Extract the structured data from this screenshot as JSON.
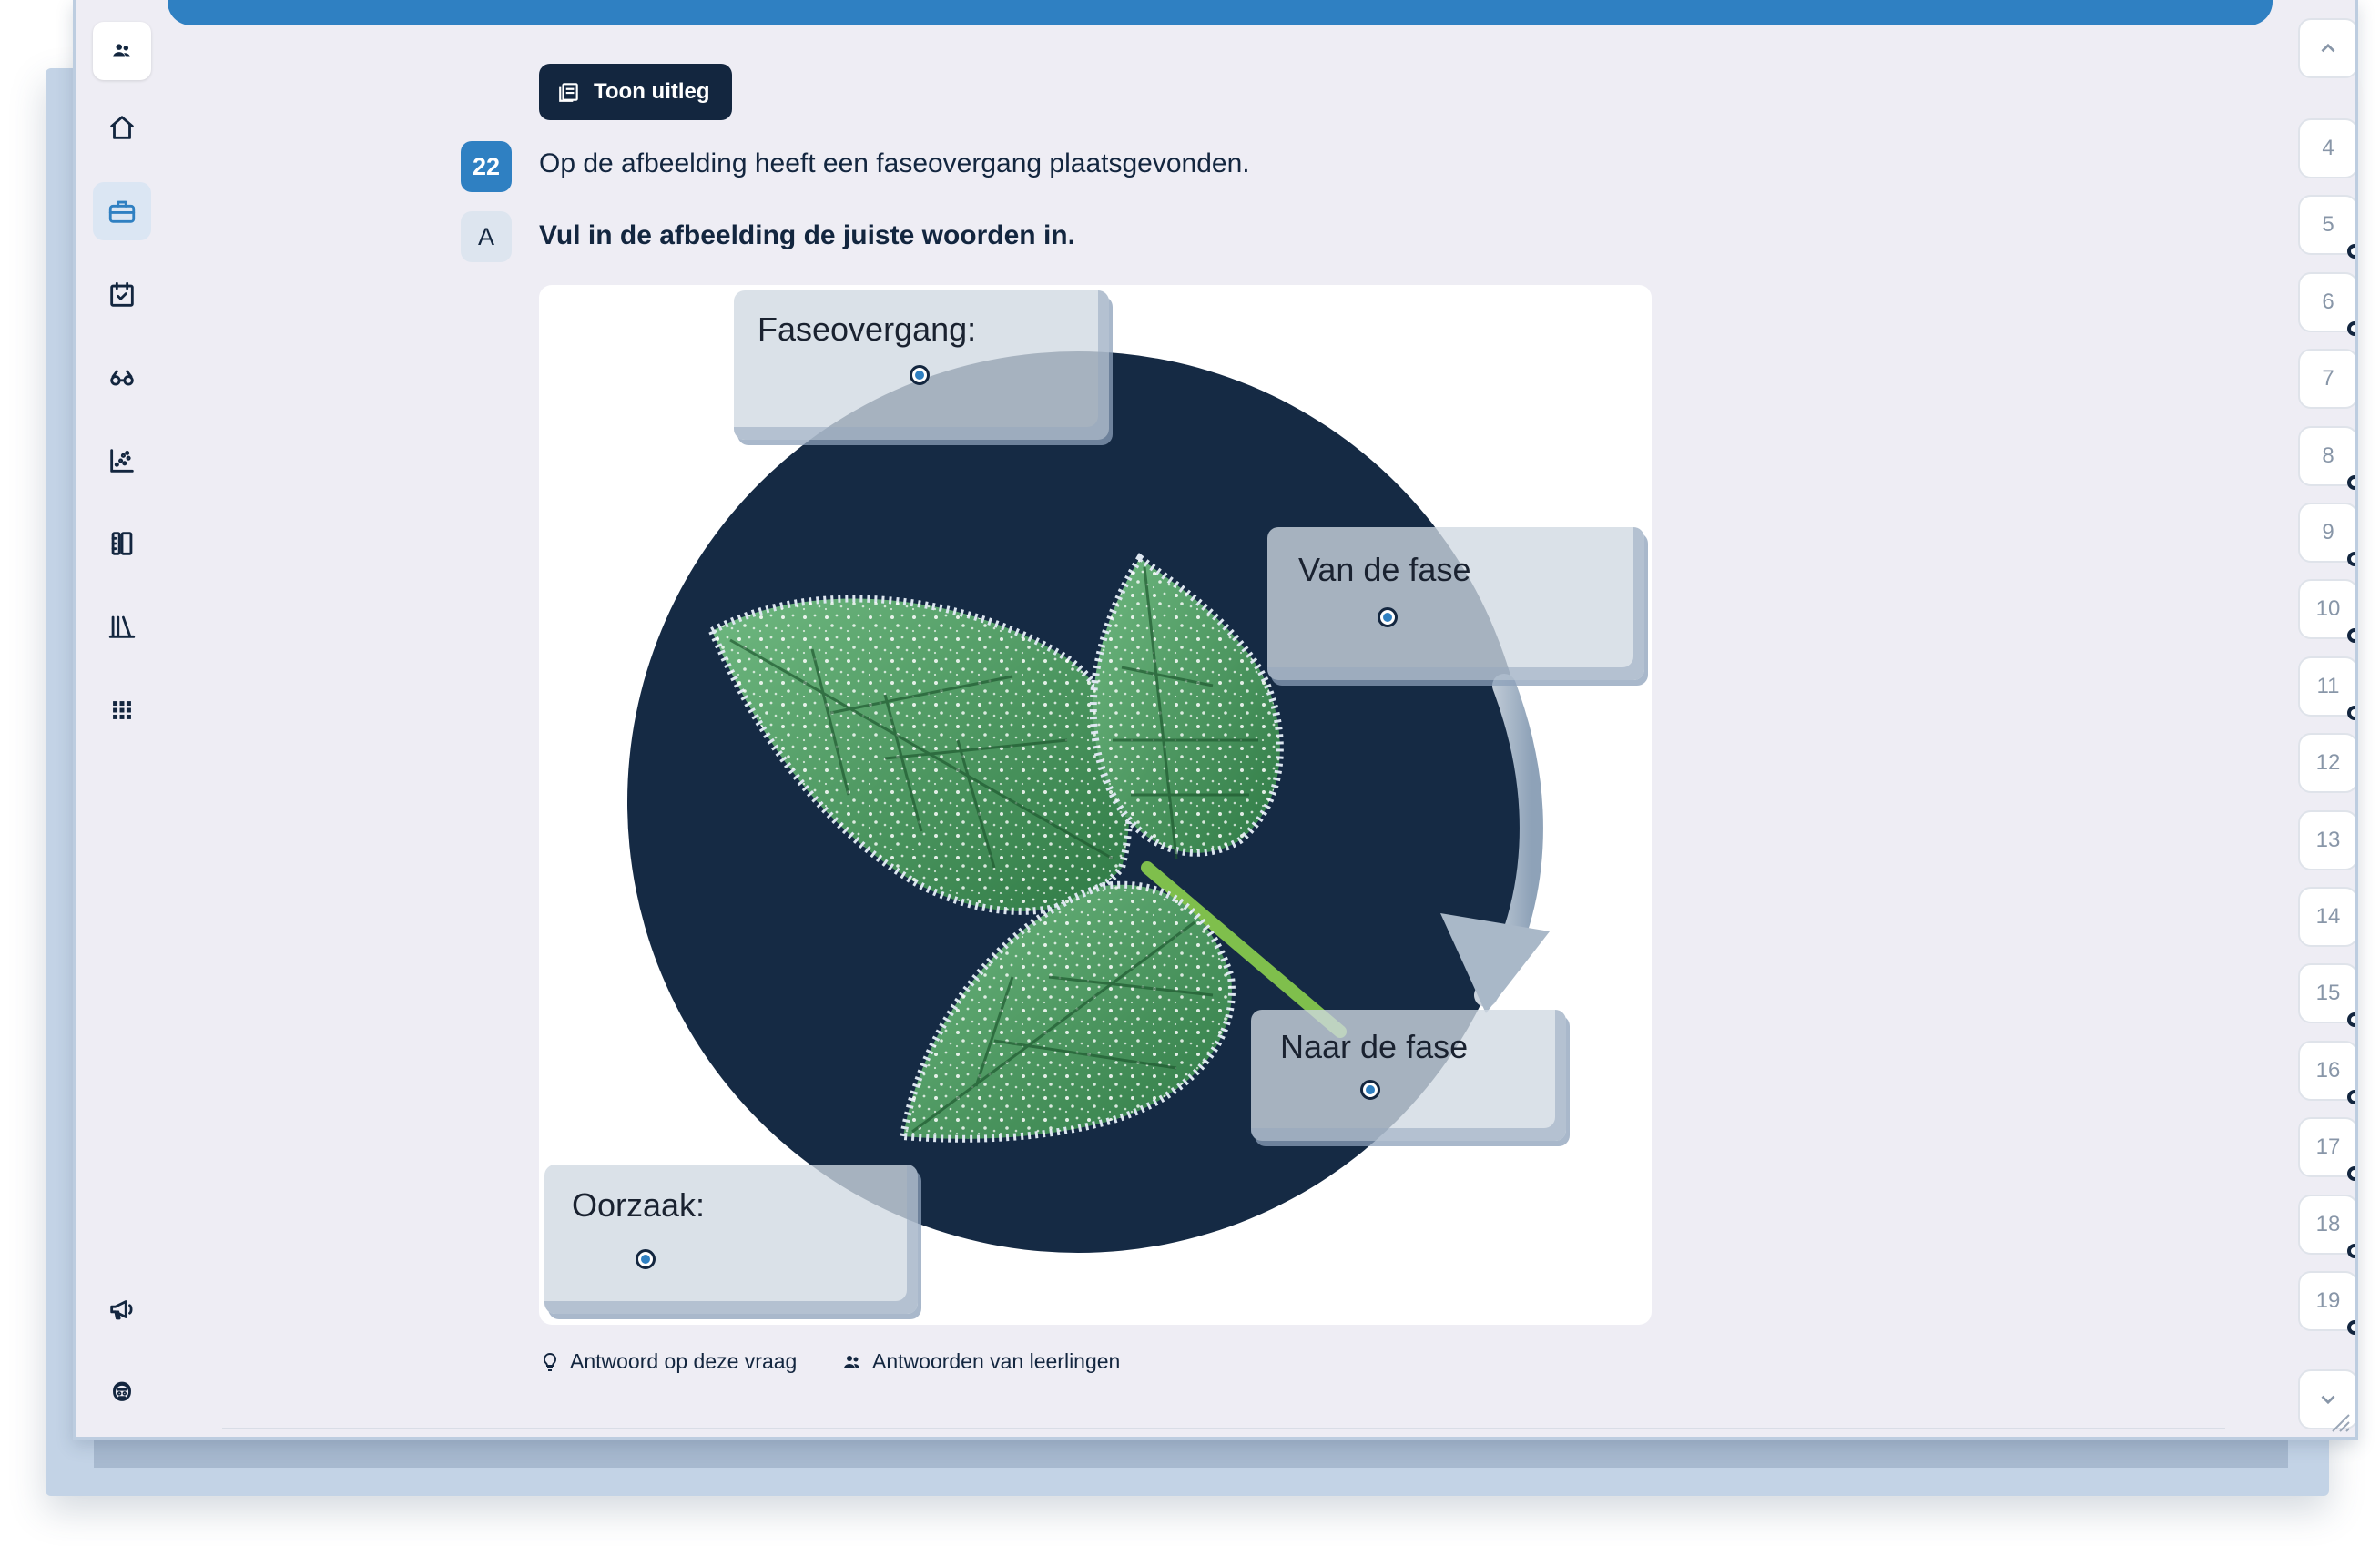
{
  "explain_button": {
    "label": "Toon uitleg",
    "icon": "book-icon"
  },
  "question": {
    "number": "22",
    "text": "Op de afbeelding heeft een faseovergang plaatsgevonden.",
    "sub_label": "A",
    "instruction": "Vul in de afbeelding de juiste woorden in."
  },
  "drop_fields": {
    "faseovergang": "Faseovergang:",
    "van": "Van de fase",
    "naar": "Naar de fase",
    "oorzaak": "Oorzaak:"
  },
  "footer": {
    "answer_label": "Antwoord op deze vraag",
    "students_label": "Antwoorden van leerlingen"
  },
  "sidebar": [
    {
      "name": "profile-icon"
    },
    {
      "name": "home-icon"
    },
    {
      "name": "briefcase-icon"
    },
    {
      "name": "calendar-check-icon"
    },
    {
      "name": "glasses-icon"
    },
    {
      "name": "scatter-chart-icon"
    },
    {
      "name": "ruler-book-icon"
    },
    {
      "name": "library-icon"
    },
    {
      "name": "apps-grid-icon"
    },
    {
      "name": "megaphone-icon"
    },
    {
      "name": "support-agent-icon"
    }
  ],
  "question_nav": [
    {
      "label": "4",
      "answered": false
    },
    {
      "label": "5",
      "answered": true
    },
    {
      "label": "6",
      "answered": true
    },
    {
      "label": "7",
      "answered": false
    },
    {
      "label": "8",
      "answered": true
    },
    {
      "label": "9",
      "answered": true
    },
    {
      "label": "10",
      "answered": true
    },
    {
      "label": "11",
      "answered": true
    },
    {
      "label": "12",
      "answered": false
    },
    {
      "label": "13",
      "answered": false
    },
    {
      "label": "14",
      "answered": false
    },
    {
      "label": "15",
      "answered": true
    },
    {
      "label": "16",
      "answered": true
    },
    {
      "label": "17",
      "answered": true
    },
    {
      "label": "18",
      "answered": true
    },
    {
      "label": "19",
      "answered": true
    }
  ],
  "colors": {
    "accent": "#2f80c2",
    "navy": "#13263f",
    "background": "#eeedf4",
    "circle": "#152a44",
    "leaf": "#3f8f58"
  }
}
